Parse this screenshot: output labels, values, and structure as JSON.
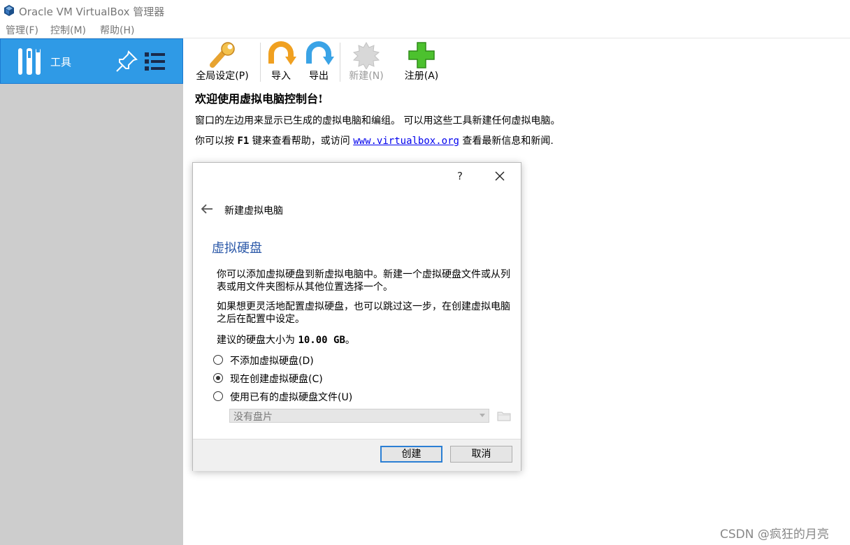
{
  "window": {
    "title": "Oracle VM VirtualBox 管理器"
  },
  "menu": [
    "管理(F)",
    "控制(M)",
    "帮助(H)"
  ],
  "sidebar": {
    "tools_label": "工具"
  },
  "toolbar": {
    "preferences": "全局设定(P)",
    "import": "导入",
    "export": "导出",
    "new": "新建(N)",
    "register": "注册(A)"
  },
  "welcome": {
    "title": "欢迎使用虚拟电脑控制台!",
    "line1": "窗口的左边用来显示已生成的虚拟电脑和编组。 可以用这些工具新建任何虚拟电脑。",
    "line2_pre": "你可以按",
    "line2_key": "F1",
    "line2_mid": "键来查看帮助，或访问",
    "line2_link": "www.virtualbox.org",
    "line2_post": "查看最新信息和新闻."
  },
  "dialog": {
    "help": "?",
    "title": "新建虚拟电脑",
    "heading": "虚拟硬盘",
    "para1": "你可以添加虚拟硬盘到新虚拟电脑中。新建一个虚拟硬盘文件或从列表或用文件夹图标从其他位置选择一个。",
    "para2": "如果想更灵活地配置虚拟硬盘，也可以跳过这一步，在创建虚拟电脑之后在配置中设定。",
    "recommend_pre": "建议的硬盘大小为",
    "recommend_size": "10.00 GB",
    "recommend_post": "。",
    "options": [
      {
        "label": "不添加虚拟硬盘(D)",
        "checked": false
      },
      {
        "label": "现在创建虚拟硬盘(C)",
        "checked": true
      },
      {
        "label": "使用已有的虚拟硬盘文件(U)",
        "checked": false
      }
    ],
    "disk_select_value": "没有盘片",
    "create_button": "创建",
    "cancel_button": "取消"
  },
  "watermark": "CSDN @疯狂的月亮"
}
